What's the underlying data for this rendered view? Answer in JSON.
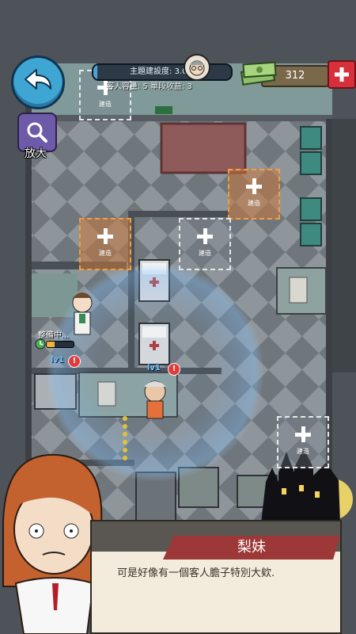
{
  "hud": {
    "progress_label": "主題建設度: 3.0%",
    "progress_value": 3.0,
    "stats": "客人容量: 5   單段收益: 3",
    "money": "312",
    "zoom_label": "放大"
  },
  "build_slots": [
    {
      "label": "建造"
    },
    {
      "label": "建造"
    },
    {
      "label": "建造"
    },
    {
      "label": "建造"
    },
    {
      "label": "建造"
    }
  ],
  "characters": {
    "worker_status": "整備中...",
    "worker_level": "lv1",
    "patient_level": "lv1",
    "alert_symbol": "!"
  },
  "dialogue": {
    "speaker": "梨妹",
    "text": "可是好像有一個客人膽子特別大欸."
  },
  "colors": {
    "back_button": "#3fa6d4",
    "zoom_button": "#6d5aa8",
    "add_money_button": "#d8303b",
    "build_slot_orange": "#f0a044",
    "name_plate": "#9c3838"
  }
}
